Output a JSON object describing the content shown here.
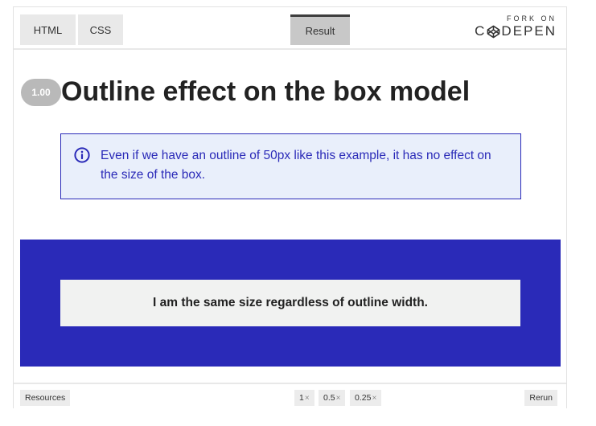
{
  "tabs": {
    "html_label": "HTML",
    "css_label": "CSS",
    "result_label": "Result"
  },
  "codepen": {
    "fork_on": "FORK ON",
    "brand_left": "C",
    "brand_right": "DEPEN"
  },
  "main": {
    "version": "1.00",
    "title": "Outline effect on the box model",
    "info_text": "Even if we have an outline of 50px like this example, it has no effect on the size of the box.",
    "box_text": "I am the same size regardless of outline width.",
    "colors": {
      "accent": "#2a2ab8",
      "info_bg": "#e9effb",
      "box_bg": "#f1f2f1"
    }
  },
  "bottom": {
    "resources_label": "Resources",
    "zoom_options": [
      {
        "label": "1",
        "suffix": "×"
      },
      {
        "label": "0.5",
        "suffix": "×"
      },
      {
        "label": "0.25",
        "suffix": "×"
      }
    ],
    "rerun_label": "Rerun"
  },
  "icons": {
    "info": "info-circle-icon",
    "codepen_logo": "codepen-logo-icon"
  }
}
